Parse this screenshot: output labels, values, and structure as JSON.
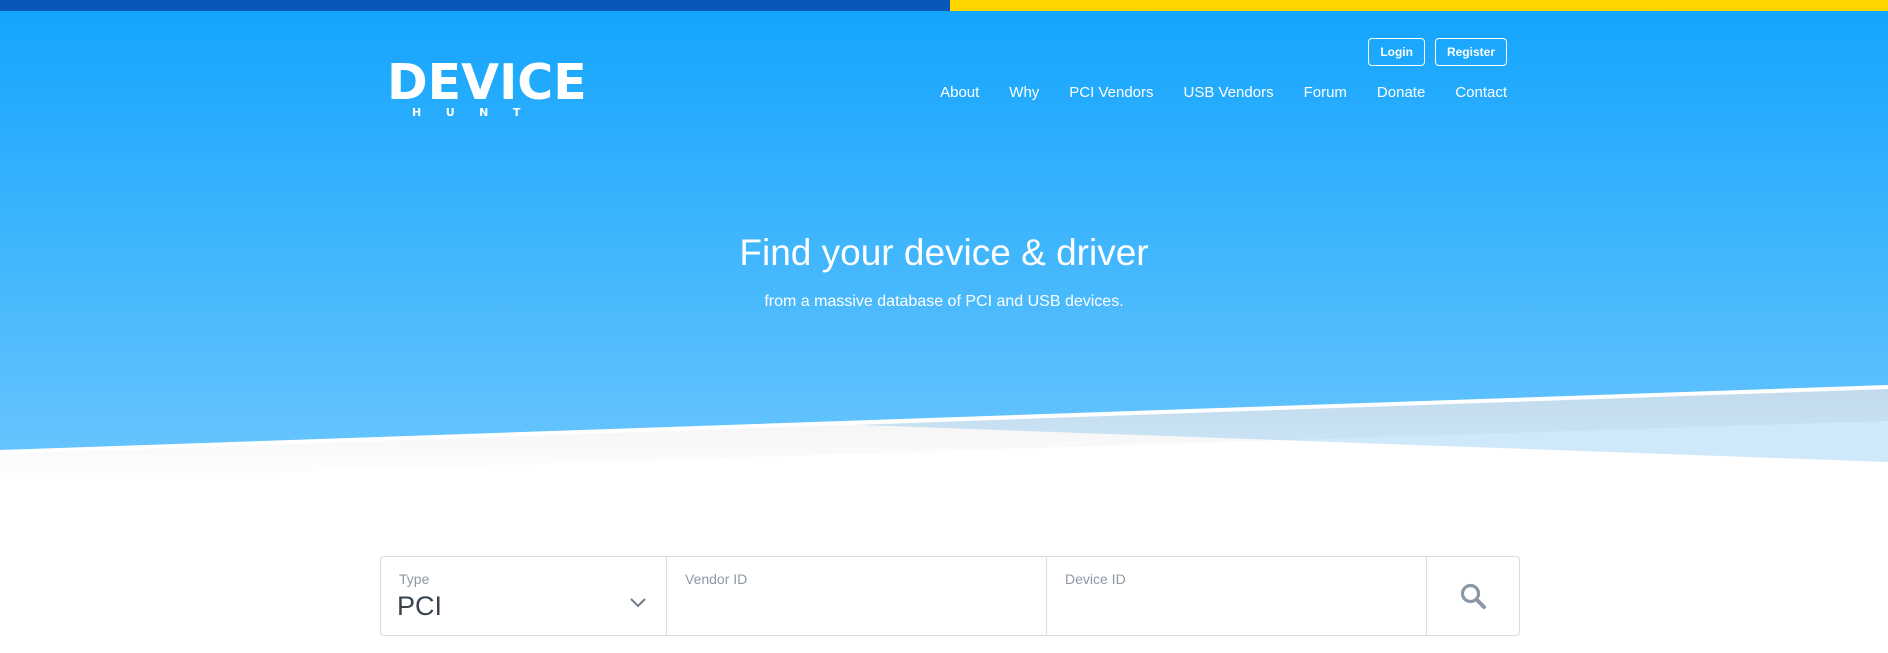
{
  "colors": {
    "flag_blue": "#0a57b8",
    "flag_yellow": "#ffd500",
    "hero_top": "#14a5fd",
    "hero_bottom": "#66c4fd",
    "hero_light_wedge": "#cfe9fb",
    "text_muted": "#8c97a6",
    "border": "#d9dde3"
  },
  "logo": {
    "main": "DEVICE",
    "sub": "HUNT"
  },
  "auth": {
    "login_label": "Login",
    "register_label": "Register"
  },
  "nav": {
    "items": [
      {
        "label": "About"
      },
      {
        "label": "Why"
      },
      {
        "label": "PCI Vendors"
      },
      {
        "label": "USB Vendors"
      },
      {
        "label": "Forum"
      },
      {
        "label": "Donate"
      },
      {
        "label": "Contact"
      }
    ]
  },
  "hero": {
    "title": "Find your device & driver",
    "subtitle": "from a massive database of PCI and USB devices."
  },
  "search": {
    "type_label": "Type",
    "type_value": "PCI",
    "vendor_label": "Vendor ID",
    "vendor_value": "",
    "device_label": "Device ID",
    "device_value": "",
    "type_icon": "chevron-down-icon",
    "search_icon": "search-icon"
  }
}
